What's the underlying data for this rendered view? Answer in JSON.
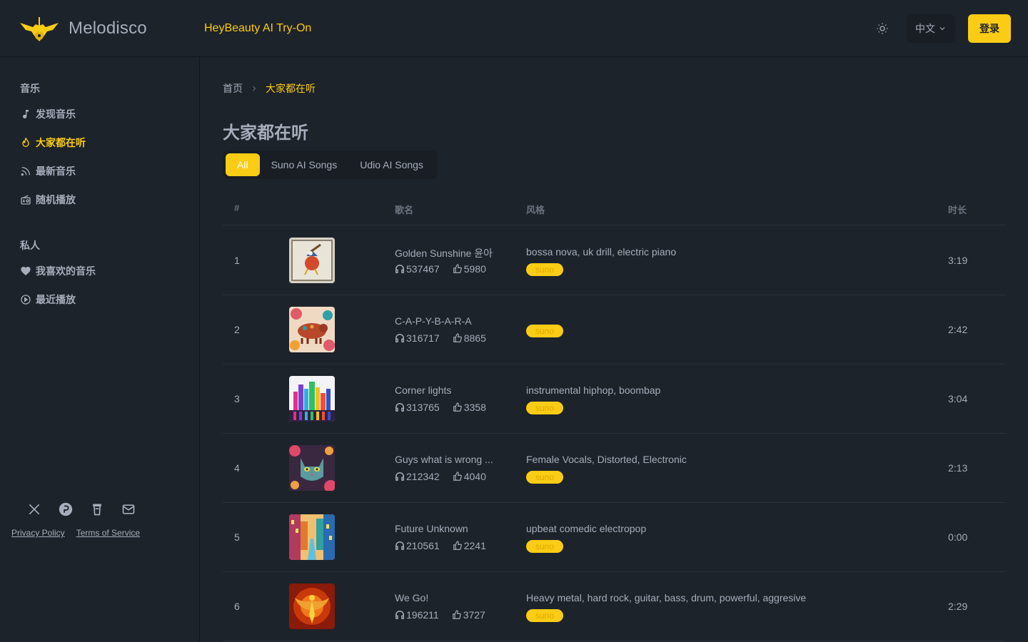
{
  "header": {
    "app_name": "Melodisco",
    "promo_link": "HeyBeauty AI Try-On",
    "language": "中文",
    "login": "登录"
  },
  "sidebar": {
    "music_heading": "音乐",
    "music_items": [
      {
        "label": "发现音乐",
        "icon": "music-note-icon"
      },
      {
        "label": "大家都在听",
        "icon": "flame-icon",
        "active": true
      },
      {
        "label": "最新音乐",
        "icon": "rss-icon"
      },
      {
        "label": "随机播放",
        "icon": "radio-icon"
      }
    ],
    "private_heading": "私人",
    "private_items": [
      {
        "label": "我喜欢的音乐",
        "icon": "heart-icon"
      },
      {
        "label": "最近播放",
        "icon": "play-circle-icon"
      }
    ],
    "social_icons": [
      "x-icon",
      "product-hunt-icon",
      "coffee-cup-icon",
      "mail-icon"
    ],
    "privacy": "Privacy Policy",
    "terms": "Terms of Service"
  },
  "breadcrumb": {
    "home": "首页",
    "current": "大家都在听"
  },
  "page_title": "大家都在听",
  "tabs": [
    "All",
    "Suno AI Songs",
    "Udio AI Songs"
  ],
  "table": {
    "headers": {
      "index": "#",
      "name": "歌名",
      "style": "风格",
      "duration": "时长"
    },
    "rows": [
      {
        "index": "1",
        "name": "Golden Sunshine 윤아",
        "plays": "537467",
        "likes": "5980",
        "style": "bossa nova, uk drill, electric piano",
        "badge": "suno",
        "duration": "3:19"
      },
      {
        "index": "2",
        "name": "C-A-P-Y-B-A-R-A",
        "plays": "316717",
        "likes": "8865",
        "style": "",
        "badge": "suno",
        "duration": "2:42"
      },
      {
        "index": "3",
        "name": "Corner lights",
        "plays": "313765",
        "likes": "3358",
        "style": "instrumental hiphop, boombap",
        "badge": "suno",
        "duration": "3:04"
      },
      {
        "index": "4",
        "name": "Guys what is wrong ...",
        "plays": "212342",
        "likes": "4040",
        "style": "Female Vocals, Distorted, Electronic",
        "badge": "suno",
        "duration": "2:13"
      },
      {
        "index": "5",
        "name": "Future Unknown",
        "plays": "210561",
        "likes": "2241",
        "style": "upbeat comedic electropop",
        "badge": "suno",
        "duration": "0:00"
      },
      {
        "index": "6",
        "name": "We Go!",
        "plays": "196211",
        "likes": "3727",
        "style": "Heavy metal, hard rock, guitar, bass, drum, powerful, aggresive",
        "badge": "suno",
        "duration": "2:29"
      }
    ]
  },
  "colors": {
    "accent": "#facc15",
    "background": "#1d232a",
    "text": "#a6adbb"
  }
}
